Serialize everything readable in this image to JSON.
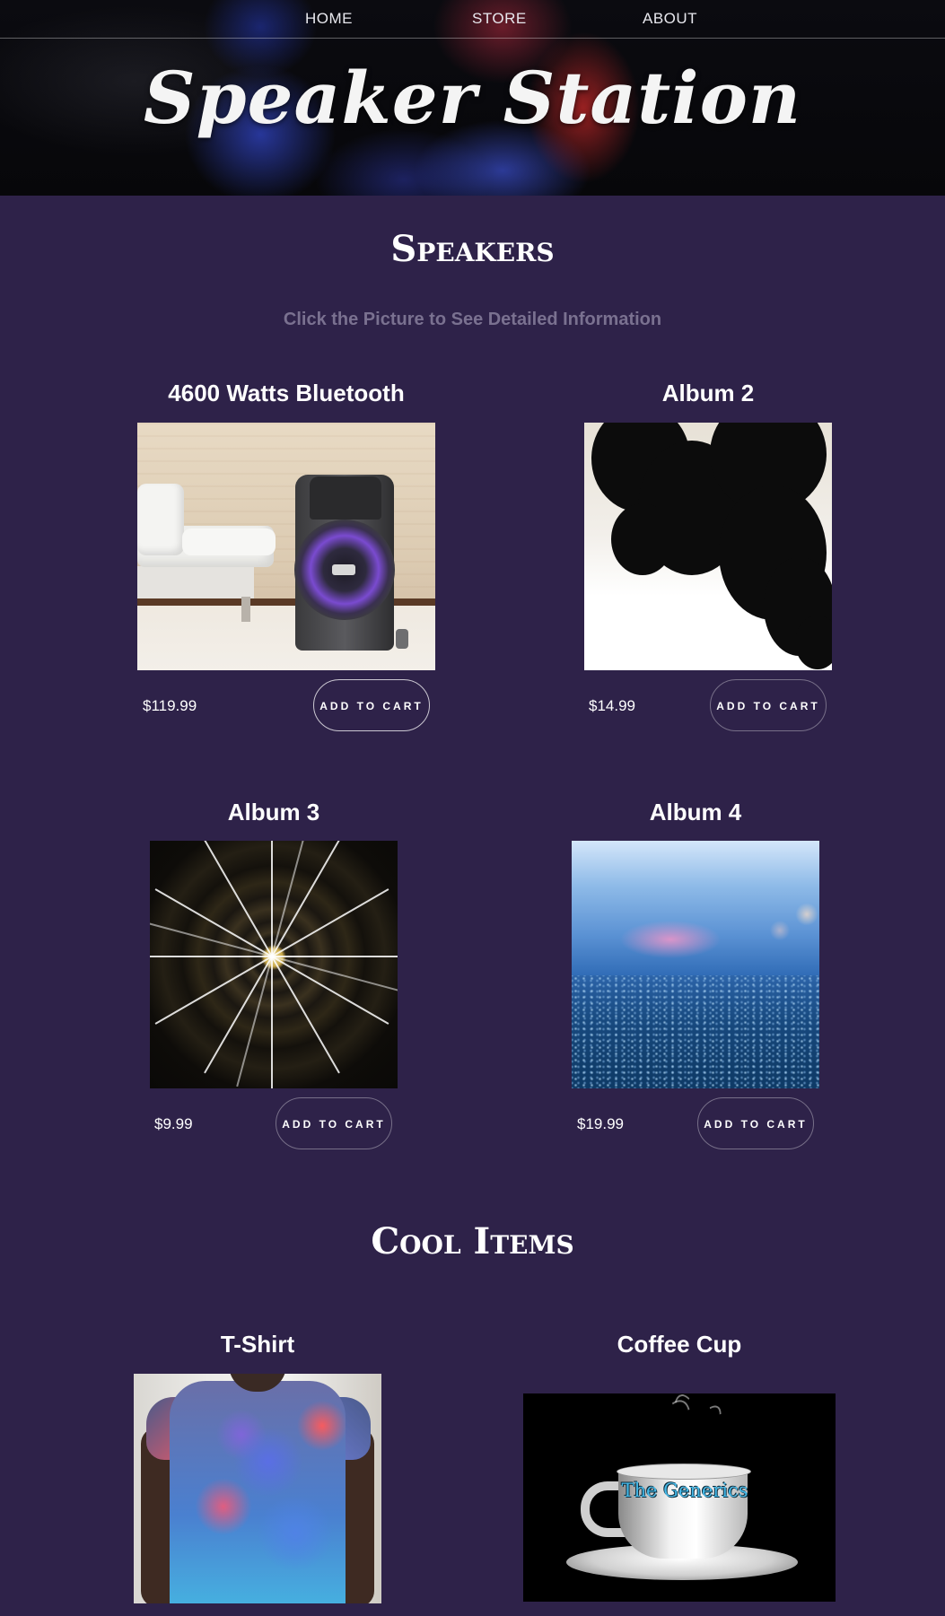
{
  "nav": {
    "items": [
      {
        "label": "HOME"
      },
      {
        "label": "STORE"
      },
      {
        "label": "ABOUT"
      }
    ]
  },
  "header": {
    "title": "Speaker Station"
  },
  "speakers_section": {
    "heading": "Speakers",
    "subtitle": "Click the Picture to See Detailed Information",
    "products": [
      {
        "title": "4600 Watts Bluetooth",
        "price": "$119.99",
        "button": "ADD TO CART",
        "image": "speaker-beside-white-sofa"
      },
      {
        "title": "Album 2",
        "price": "$14.99",
        "button": "ADD TO CART",
        "image": "black-ink-in-water"
      },
      {
        "title": "Album 3",
        "price": "$9.99",
        "button": "ADD TO CART",
        "image": "radial-light-dome"
      },
      {
        "title": "Album 4",
        "price": "$19.99",
        "button": "ADD TO CART",
        "image": "blue-bokeh-ground"
      }
    ]
  },
  "cool_items_section": {
    "heading": "Cool Items",
    "products": [
      {
        "title": "T-Shirt",
        "image": "smoke-print-tshirt"
      },
      {
        "title": "Coffee Cup",
        "image": "steaming-white-coffee-cup",
        "brand_text": "The Generics"
      }
    ]
  },
  "colors": {
    "page_background": "#2e2249",
    "subtitle_text": "#7a7190",
    "heading_text": "#ffffff"
  }
}
